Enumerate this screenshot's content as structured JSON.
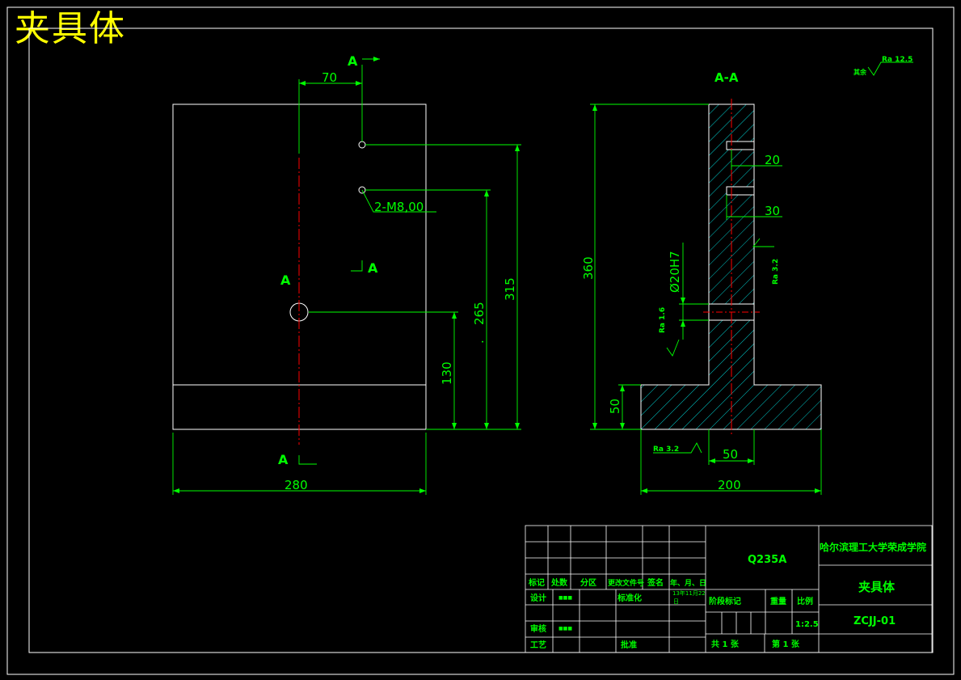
{
  "drawing_title": "夹具体",
  "colors": {
    "background": "#000000",
    "frame": "#ffffff",
    "geometry": "#ffffff",
    "dimension": "#00ff00",
    "centerline": "#ff0000",
    "hatch": "#00ffff",
    "title_yellow": "#ffff00",
    "titleblock_text": "#00ff00"
  },
  "front_view": {
    "section_label": "A",
    "dims": {
      "top_offset": "70",
      "width": "280",
      "hole_center_h": "130",
      "h265": "265",
      "h315": "315",
      "dot_mark": "."
    },
    "thread_callout": "2-M8,00"
  },
  "section_view": {
    "title": "A-A",
    "dims": {
      "height": "360",
      "base_h": "50",
      "web_w": "50",
      "base_w": "200",
      "d20": "20",
      "d30": "30",
      "bore": "Ø20H7"
    },
    "roughness": {
      "right": "Ra 3.2",
      "left": "Ra 1.6",
      "bottom": "Ra 3.2",
      "general": "Ra 12.5",
      "general_note": "其余"
    }
  },
  "title_block": {
    "material": "Q235A",
    "school": "哈尔滨理工大学荣成学院",
    "part_name": "夹具体",
    "drawing_no": "ZCJJ-01",
    "headers": {
      "mark": "标记",
      "count": "处数",
      "zone": "分区",
      "doc": "更改文件号",
      "sign": "签名",
      "date": "年、月、日"
    },
    "rows": {
      "design": "设计",
      "standard": "标准化",
      "check": "审核",
      "process": "工艺",
      "approve": "批准"
    },
    "stage": "阶段标记",
    "weight": "重量",
    "scale_label": "比例",
    "scale": "1:2.5",
    "designer": "■■■",
    "reviewer": "■■■",
    "date_value": "13年11月22",
    "date_tail": "日",
    "sheets_total": "共 1 张",
    "sheet_no": "第 1 张"
  }
}
